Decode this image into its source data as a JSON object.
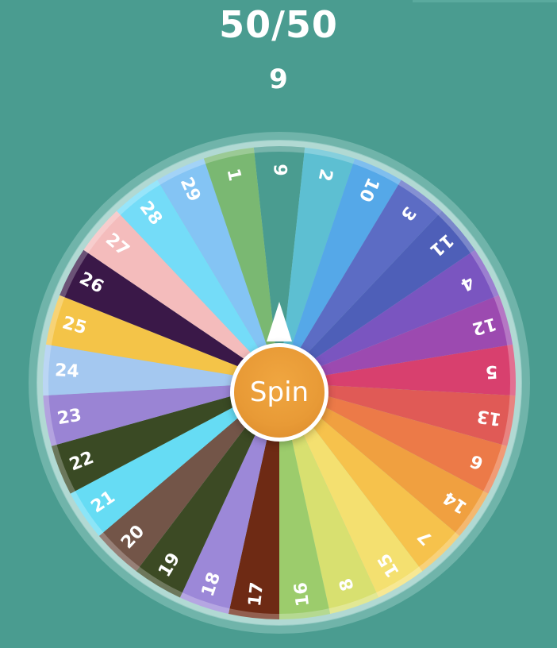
{
  "header": {
    "score": "50/50",
    "result": "9"
  },
  "spin_label": "Spin",
  "wheel": {
    "segments": [
      {
        "label": "9",
        "color": "#4a9c90"
      },
      {
        "label": "2",
        "color": "#5dbfd2"
      },
      {
        "label": "10",
        "color": "#55a8e8"
      },
      {
        "label": "3",
        "color": "#5c6cc4"
      },
      {
        "label": "11",
        "color": "#4e5fb8"
      },
      {
        "label": "4",
        "color": "#7a55c0"
      },
      {
        "label": "12",
        "color": "#9c4ab0"
      },
      {
        "label": "5",
        "color": "#d8406e"
      },
      {
        "label": "13",
        "color": "#e05a56"
      },
      {
        "label": "6",
        "color": "#ec7a48"
      },
      {
        "label": "14",
        "color": "#f0a040"
      },
      {
        "label": "7",
        "color": "#f6c24c"
      },
      {
        "label": "15",
        "color": "#f4e070"
      },
      {
        "label": "8",
        "color": "#d8e070"
      },
      {
        "label": "16",
        "color": "#9ccc6c"
      },
      {
        "label": "17",
        "color": "#6e2a14"
      },
      {
        "label": "18",
        "color": "#9c88d8"
      },
      {
        "label": "19",
        "color": "#3c4a24"
      },
      {
        "label": "20",
        "color": "#735548"
      },
      {
        "label": "21",
        "color": "#66dcf4"
      },
      {
        "label": "22",
        "color": "#3a4a24"
      },
      {
        "label": "23",
        "color": "#9a84d4"
      },
      {
        "label": "24",
        "color": "#a4c8f0"
      },
      {
        "label": "25",
        "color": "#f4c448"
      },
      {
        "label": "26",
        "color": "#3a1848"
      },
      {
        "label": "27",
        "color": "#f4bcbc"
      },
      {
        "label": "28",
        "color": "#74dcf8"
      },
      {
        "label": "29",
        "color": "#84c4f4"
      },
      {
        "label": "1",
        "color": "#7ab872"
      }
    ]
  }
}
